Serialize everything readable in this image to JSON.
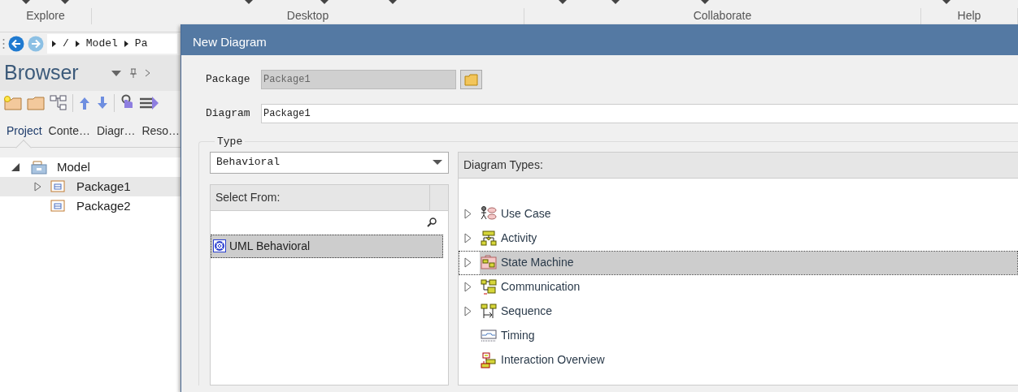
{
  "ribbon": {
    "groups": [
      {
        "label": "Explore"
      },
      {
        "label": "Desktop"
      },
      {
        "label": "Collaborate"
      },
      {
        "label": "Help"
      }
    ]
  },
  "breadcrumb": [
    "/",
    "Model",
    "Pa"
  ],
  "browser": {
    "title": "Browser",
    "tabs": [
      {
        "label": "Project",
        "selected": true
      },
      {
        "label": "Conte…",
        "selected": false
      },
      {
        "label": "Diagr…",
        "selected": false
      },
      {
        "label": "Reso…",
        "selected": false
      }
    ],
    "tree": [
      {
        "label": "Model",
        "kind": "model",
        "expanded": true,
        "selected": false,
        "children": [
          {
            "label": "Package1",
            "kind": "package",
            "expanded": false,
            "selected": true
          },
          {
            "label": "Package2",
            "kind": "package",
            "selected": false
          }
        ]
      }
    ]
  },
  "dialog": {
    "title": "New Diagram",
    "package": {
      "label": "Package",
      "value": "Package1"
    },
    "diagram": {
      "label": "Diagram",
      "value": "Package1"
    },
    "type": {
      "label": "Type",
      "value": "Behavioral"
    },
    "select_from": {
      "header": "Select From:",
      "items": [
        {
          "label": "UML Behavioral",
          "selected": true
        }
      ]
    },
    "diagram_types": {
      "header": "Diagram Types:",
      "items": [
        {
          "label": "Use Case",
          "kind": "use-case",
          "expanded": false,
          "selected": false
        },
        {
          "label": "Activity",
          "kind": "activity",
          "expanded": false,
          "selected": false
        },
        {
          "label": "State Machine",
          "kind": "state-machine",
          "expanded": false,
          "selected": true
        },
        {
          "label": "Communication",
          "kind": "communication",
          "expanded": false,
          "selected": false
        },
        {
          "label": "Sequence",
          "kind": "sequence",
          "expanded": false,
          "selected": false
        },
        {
          "label": "Timing",
          "kind": "timing",
          "selected": false
        },
        {
          "label": "Interaction Overview",
          "kind": "interaction-overview",
          "selected": false
        }
      ]
    }
  }
}
